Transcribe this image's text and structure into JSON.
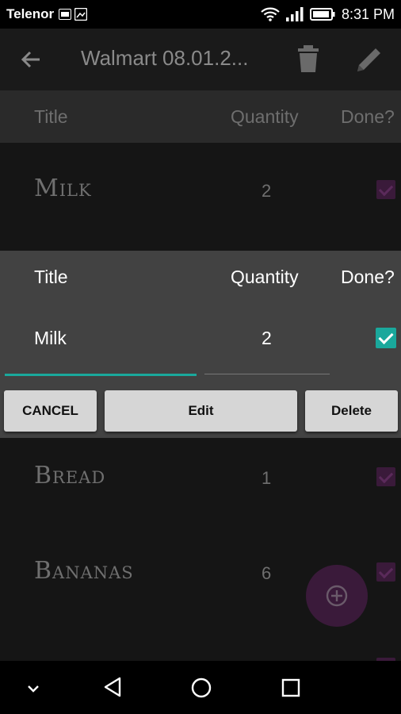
{
  "status_bar": {
    "carrier": "Telenor",
    "time": "8:31 PM"
  },
  "app_bar": {
    "title": "Walmart  08.01.2..."
  },
  "table_header": {
    "title": "Title",
    "quantity": "Quantity",
    "done": "Done?"
  },
  "rows": [
    {
      "name": "Milk",
      "quantity": "2",
      "done": true
    },
    {
      "name": "Bread",
      "quantity": "1",
      "done": true
    },
    {
      "name": "Bananas",
      "quantity": "6",
      "done": true
    }
  ],
  "dialog": {
    "header_title": "Title",
    "header_quantity": "Quantity",
    "header_done": "Done?",
    "title_value": "Milk",
    "quantity_value": "2",
    "done_checked": true,
    "cancel_label": "CANCEL",
    "edit_label": "Edit",
    "delete_label": "Delete"
  },
  "colors": {
    "accent": "#1aa89c",
    "fab": "#3a1a3a",
    "dialog_bg": "#424242"
  }
}
